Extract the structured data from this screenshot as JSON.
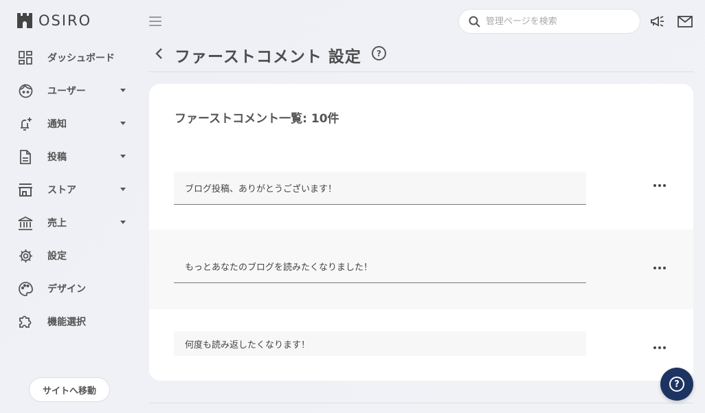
{
  "brand": {
    "name": "OSIRO"
  },
  "sidebar": {
    "items": [
      {
        "label": "ダッシュボード",
        "icon": "dashboard-icon",
        "has_submenu": false
      },
      {
        "label": "ユーザー",
        "icon": "user-face-icon",
        "has_submenu": true
      },
      {
        "label": "通知",
        "icon": "bell-plus-icon",
        "has_submenu": true
      },
      {
        "label": "投稿",
        "icon": "document-icon",
        "has_submenu": true
      },
      {
        "label": "ストア",
        "icon": "store-icon",
        "has_submenu": true
      },
      {
        "label": "売上",
        "icon": "bank-icon",
        "has_submenu": true
      },
      {
        "label": "設定",
        "icon": "gear-icon",
        "has_submenu": false
      },
      {
        "label": "デザイン",
        "icon": "palette-icon",
        "has_submenu": false
      },
      {
        "label": "機能選択",
        "icon": "puzzle-icon",
        "has_submenu": false
      }
    ],
    "site_button_label": "サイトへ移動"
  },
  "header": {
    "search_placeholder": "管理ページを検索"
  },
  "page": {
    "title": "ファーストコメント 設定",
    "help_glyph": "?"
  },
  "card": {
    "title": "ファーストコメント一覧: 10件",
    "comments": [
      {
        "text": "ブログ投稿、ありがとうございます！"
      },
      {
        "text": "もっとあなたのブログを読みたくなりました！"
      },
      {
        "text": "何度も読み返したくなります！"
      }
    ]
  },
  "fab": {
    "glyph": "?"
  },
  "colors": {
    "accent": "#1d3462",
    "text": "#555555",
    "background": "#eef0f5"
  }
}
